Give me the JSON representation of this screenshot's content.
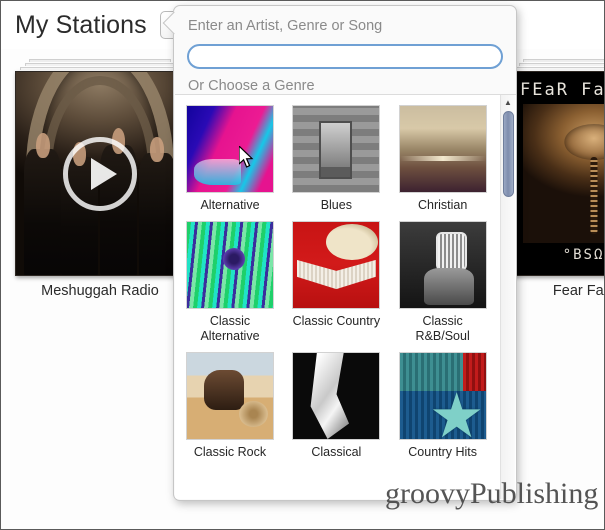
{
  "header": {
    "title": "My Stations",
    "add_button_label": "+"
  },
  "stations": [
    {
      "name": "Meshuggah Radio",
      "play_label": "play-station"
    },
    {
      "name": "Fear Factory",
      "art_band_text": "FEaR FaC",
      "art_album_text": "°BSΩLE"
    }
  ],
  "popup": {
    "title": "Enter an Artist, Genre or Song",
    "search": {
      "value": "",
      "placeholder": ""
    },
    "subtitle": "Or Choose a Genre",
    "genres": [
      {
        "label": "Alternative",
        "thumb": "alternative-thumb"
      },
      {
        "label": "Blues",
        "thumb": "blues-thumb"
      },
      {
        "label": "Christian",
        "thumb": "christian-thumb"
      },
      {
        "label": "Classic Alternative",
        "thumb": "classic-alternative-thumb"
      },
      {
        "label": "Classic Country",
        "thumb": "classic-country-thumb"
      },
      {
        "label": "Classic R&B/Soul",
        "thumb": "classic-rnb-soul-thumb"
      },
      {
        "label": "Classic Rock",
        "thumb": "classic-rock-thumb"
      },
      {
        "label": "Classical",
        "thumb": "classical-thumb"
      },
      {
        "label": "Country Hits",
        "thumb": "country-hits-thumb"
      }
    ],
    "scrollbar": {
      "up_arrow": "▲"
    }
  },
  "watermark": {
    "text": "groovyPublishing"
  },
  "colors": {
    "accent_blue": "#6fa0d4",
    "popup_bg": "#fafafa",
    "scrollbar_thumb": "#7e8dad",
    "label_text": "#262626",
    "muted_text": "#8a8a8a"
  }
}
